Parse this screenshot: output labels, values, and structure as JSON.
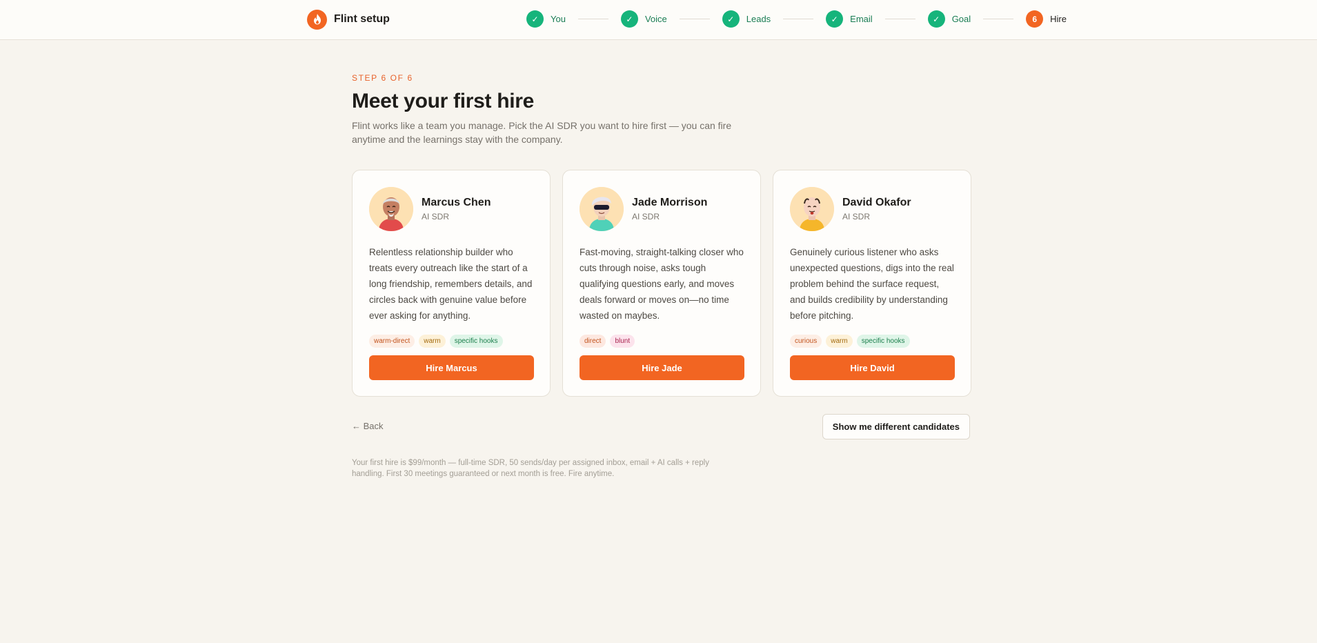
{
  "brand": {
    "name": "Flint setup",
    "logo_icon": "flame-icon",
    "accent": "#f26522"
  },
  "stepper": {
    "steps": [
      {
        "label": "You",
        "state": "done",
        "marker": "✓"
      },
      {
        "label": "Voice",
        "state": "done",
        "marker": "✓"
      },
      {
        "label": "Leads",
        "state": "done",
        "marker": "✓"
      },
      {
        "label": "Email",
        "state": "done",
        "marker": "✓"
      },
      {
        "label": "Goal",
        "state": "done",
        "marker": "✓"
      },
      {
        "label": "Hire",
        "state": "current",
        "marker": "6"
      }
    ],
    "done_color": "#16b47b"
  },
  "header": {
    "eyebrow": "STEP 6 OF 6",
    "title": "Meet your first hire",
    "subtitle": "Flint works like a team you manage. Pick the AI SDR you want to hire first — you can fire anytime and the learnings stay with the company."
  },
  "candidates": [
    {
      "name": "Marcus Chen",
      "role": "AI SDR",
      "avatar_icon": "avatar-marcus-icon",
      "description": "Relentless relationship builder who treats every outreach like the start of a long friendship, remembers details, and circles back with genuine value before ever asking for anything.",
      "tags": [
        "warm-direct",
        "warm",
        "specific hooks"
      ],
      "button": "Hire Marcus"
    },
    {
      "name": "Jade Morrison",
      "role": "AI SDR",
      "avatar_icon": "avatar-jade-icon",
      "description": "Fast-moving, straight-talking closer who cuts through noise, asks tough qualifying questions early, and moves deals forward or moves on—no time wasted on maybes.",
      "tags": [
        "direct",
        "blunt"
      ],
      "button": "Hire Jade"
    },
    {
      "name": "David Okafor",
      "role": "AI SDR",
      "avatar_icon": "avatar-david-icon",
      "description": "Genuinely curious listener who asks unexpected questions, digs into the real problem behind the surface request, and builds credibility by understanding before pitching.",
      "tags": [
        "curious",
        "warm",
        "specific hooks"
      ],
      "button": "Hire David"
    }
  ],
  "actions": {
    "back": "← Back",
    "different": "Show me different candidates"
  },
  "footnote": "Your first hire is $99/month — full-time SDR, 50 sends/day per assigned inbox, email + AI calls + reply handling. First 30 meetings guaranteed or next month is free. Fire anytime."
}
